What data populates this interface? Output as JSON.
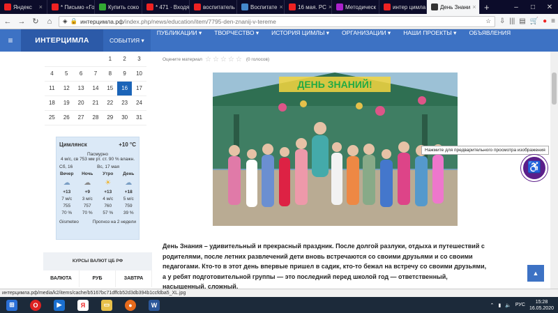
{
  "tabs": [
    {
      "label": "Яндекс",
      "color": "#e22"
    },
    {
      "label": "* Письмо «Го",
      "color": "#e22"
    },
    {
      "label": "Купить соко",
      "color": "#3a3"
    },
    {
      "label": "* 471 · Входящ",
      "color": "#e22"
    },
    {
      "label": "воспитатель ·",
      "color": "#e22"
    },
    {
      "label": "Воспитате",
      "color": "#48c"
    },
    {
      "label": "16 мая. РС",
      "color": "#e22"
    },
    {
      "label": "Методическ",
      "color": "#a2c"
    },
    {
      "label": "интер цимла",
      "color": "#e22"
    },
    {
      "label": "День Знани",
      "color": "#333"
    }
  ],
  "newtab": "+",
  "url": {
    "domain": "интерцимла.рф",
    "path": "/index.php/news/education/item/7795-den-znanij-v-tereme"
  },
  "site": {
    "logo": "ИНТЕРЦИМЛА",
    "menu": [
      "СОБЫТИЯ ▾",
      "ПУБЛИКАЦИИ ▾",
      "ТВОРЧЕСТВО ▾",
      "ИСТОРИЯ ЦИМЛЫ ▾",
      "ОРГАНИЗАЦИИ ▾",
      "НАШИ ПРОЕКТЫ ▾",
      "ОБЪЯВЛЕНИЯ"
    ]
  },
  "calendar": {
    "rows": [
      [
        "",
        "",
        "",
        "",
        "1",
        "2",
        "3"
      ],
      [
        "4",
        "5",
        "6",
        "7",
        "8",
        "9",
        "10"
      ],
      [
        "11",
        "12",
        "13",
        "14",
        "15",
        "16",
        "17"
      ],
      [
        "18",
        "19",
        "20",
        "21",
        "22",
        "23",
        "24"
      ],
      [
        "25",
        "26",
        "27",
        "28",
        "29",
        "30",
        "31"
      ]
    ],
    "today": "16"
  },
  "weather": {
    "city": "Цимлянск",
    "temp": "+10 °C",
    "cond": "Пасмурно",
    "details": "4 м/с, св   753 мм рт. ст.   90 % влажн.",
    "day1": "Сб, 16",
    "day2": "Вс, 17 мая",
    "heads": [
      "Вечер",
      "Ночь",
      "Утро",
      "День"
    ],
    "temps": [
      "+13",
      "+9",
      "+13",
      "+18"
    ],
    "wind": [
      "7 м/с",
      "3 м/с",
      "4 м/с",
      "5 м/с"
    ],
    "press": [
      "755",
      "757",
      "760",
      "759"
    ],
    "hum": [
      "70 %",
      "70 %",
      "57 %",
      "39 %"
    ],
    "brand": "Gismeteo",
    "forecast": "Прогноз на 2 недели"
  },
  "rates": {
    "title": "КУРСЫ ВАЛЮТ ЦБ РФ",
    "cols": [
      "ВАЛЮТА",
      "РУБ",
      "ЗАВТРА"
    ]
  },
  "article": {
    "rating_label": "Оцените материал",
    "votes": "(0 голосов)",
    "photo_banner": "ДЕНЬ ЗНАНИЙ!",
    "text": "День Знания – удивительный и прекрасный праздник. После долгой разлуки, отдыха и путешествий с родителями, после летних развлечений дети вновь встречаются со своими друзьями и со своими педагогами. Кто-то в этот день впервые пришел в садик, кто-то бежал на встречу со своими друзьями, а у ребят подготовительной группы — это последний перед школой год — ответственный, насыщенный, сложный."
  },
  "tooltip": "Нажмите для предварительного просмотра изображения",
  "status": "интерцимла.рф/media/k2/items/cache/b5167bc71dffcb52d3db394b1ccfdba5_XL.jpg",
  "tray": {
    "lang": "РУС",
    "time": "15:28",
    "date": "16.05.2020"
  }
}
